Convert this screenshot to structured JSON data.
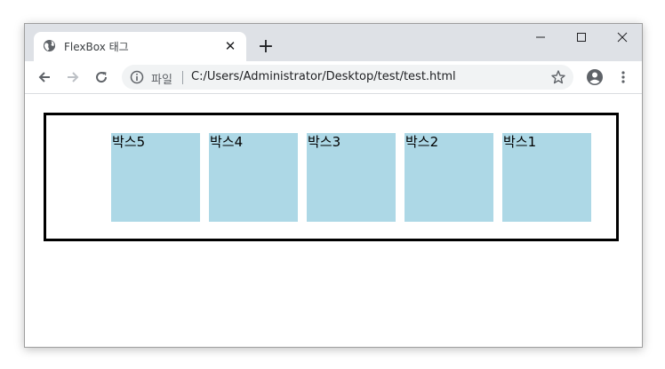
{
  "browser": {
    "tab": {
      "title": "FlexBox 태그",
      "favicon": "globe-icon",
      "close_glyph": "✕"
    },
    "new_tab_glyph": "+",
    "window_controls": {
      "minimize": "—",
      "maximize": "☐",
      "close": "✕"
    },
    "toolbar": {
      "back_icon": "arrow-left-icon",
      "forward_icon": "arrow-right-icon",
      "reload_icon": "reload-icon",
      "info_icon": "info-icon",
      "site_label": "파일",
      "url": "C:/Users/Administrator/Desktop/test/test.html",
      "bookmark_icon": "star-icon",
      "profile_icon": "account-circle-icon",
      "menu_icon": "kebab-menu-icon"
    }
  },
  "page": {
    "container_border_color": "#000000",
    "box_color": "#add8e6",
    "boxes": [
      {
        "label": "박스1"
      },
      {
        "label": "박스2"
      },
      {
        "label": "박스3"
      },
      {
        "label": "박스4"
      },
      {
        "label": "박스5"
      }
    ]
  }
}
